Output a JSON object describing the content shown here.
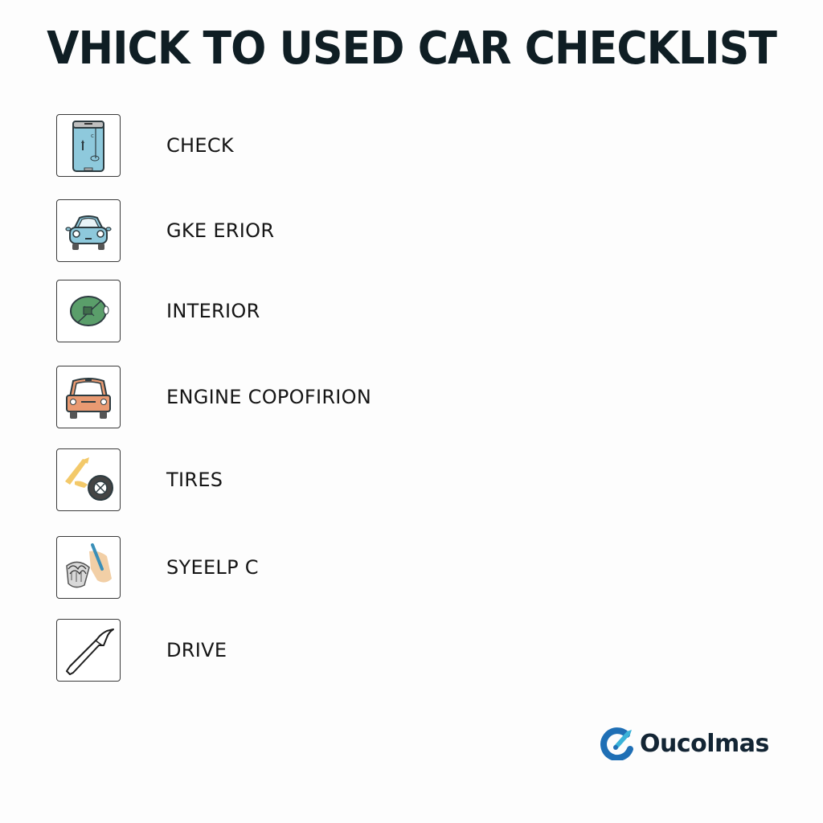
{
  "title": "VHICK TO USED CAR CHECKLIST",
  "items": [
    {
      "label": "CHECK",
      "icon": "phone-document-icon"
    },
    {
      "label": "GKE ERIOR",
      "icon": "car-front-blue-icon"
    },
    {
      "label": "INTERIOR",
      "icon": "steering-wheel-icon"
    },
    {
      "label": "ENGINE COPOFIRION",
      "icon": "car-front-orange-icon"
    },
    {
      "label": "TIRES",
      "icon": "tire-pump-icon"
    },
    {
      "label": "SYEELP C",
      "icon": "hand-brush-icon"
    },
    {
      "label": "DRIVE",
      "icon": "wrench-icon"
    }
  ],
  "brand": {
    "name": "Oucolmas",
    "icon": "brand-logo-icon",
    "colors": {
      "primary": "#1f6fb5",
      "accent": "#3bb3d9",
      "text": "#132534"
    }
  }
}
